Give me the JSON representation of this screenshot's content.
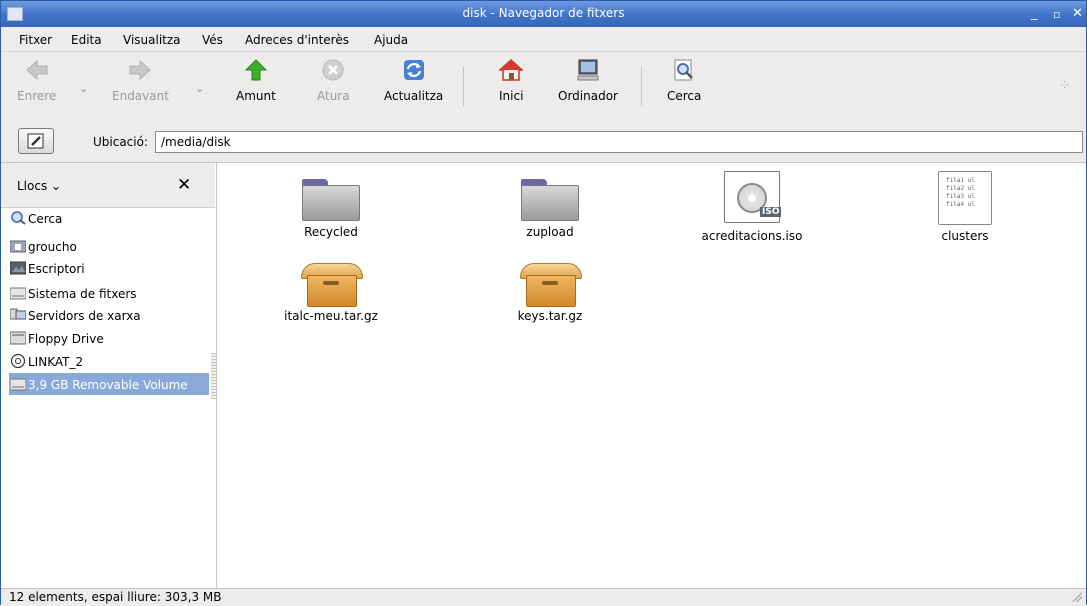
{
  "window": {
    "title": "disk - Navegador de fitxers"
  },
  "menubar": [
    "Fitxer",
    "Edita",
    "Visualitza",
    "Vés",
    "Adreces d'interès",
    "Ajuda"
  ],
  "toolbar": {
    "back": "Enrere",
    "forward": "Endavant",
    "up": "Amunt",
    "stop": "Atura",
    "reload": "Actualitza",
    "home": "Inici",
    "computer": "Ordinador",
    "search": "Cerca"
  },
  "location": {
    "label": "Ubicació:",
    "value": "/media/disk"
  },
  "sidebar": {
    "selector": "Llocs",
    "items": [
      {
        "label": "Cerca",
        "icon": "search-icon"
      },
      {
        "label": "groucho",
        "icon": "home-folder-icon"
      },
      {
        "label": "Escriptori",
        "icon": "desktop-icon"
      },
      {
        "label": "Sistema de fitxers",
        "icon": "drive-icon"
      },
      {
        "label": "Servidors de xarxa",
        "icon": "network-icon"
      },
      {
        "label": "Floppy Drive",
        "icon": "floppy-icon"
      },
      {
        "label": "LINKAT_2",
        "icon": "cdrom-icon"
      },
      {
        "label": "3,9 GB Removable Volume",
        "icon": "removable-drive-icon",
        "selected": true
      }
    ]
  },
  "files": [
    {
      "name": "Recycled",
      "type": "folder"
    },
    {
      "name": "zupload",
      "type": "folder"
    },
    {
      "name": "acreditacions.iso",
      "type": "iso",
      "badge": "ISO"
    },
    {
      "name": "clusters",
      "type": "text",
      "preview": [
        "fila1 ul",
        "fila2 ul",
        "fila3 ul",
        "fila4 ul"
      ]
    },
    {
      "name": "italc-meu.tar.gz",
      "type": "archive"
    },
    {
      "name": "keys.tar.gz",
      "type": "archive"
    }
  ],
  "status": "12 elements, espai lliure: 303,3 MB"
}
